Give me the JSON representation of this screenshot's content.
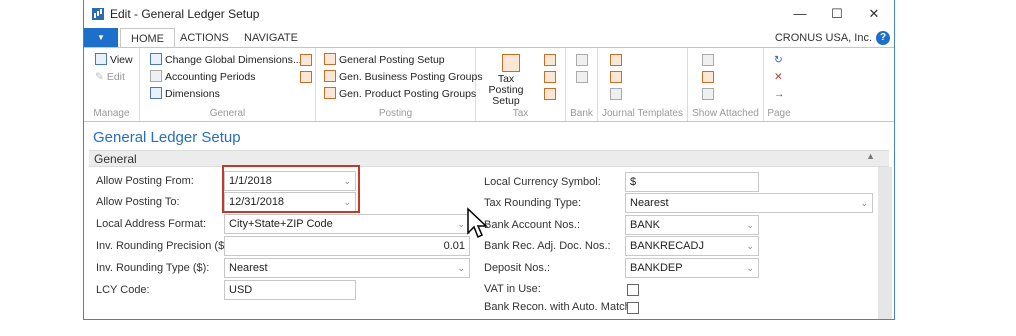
{
  "window": {
    "title": "Edit - General Ledger Setup"
  },
  "window_controls": {
    "minimize": "—",
    "maximize": "☐",
    "close": "✕"
  },
  "tabs": {
    "home": "HOME",
    "actions": "ACTIONS",
    "navigate": "NAVIGATE"
  },
  "company": "CRONUS USA, Inc.",
  "help": "?",
  "ribbon": {
    "manage": {
      "label": "Manage",
      "view": "View",
      "edit": "Edit"
    },
    "general": {
      "label": "General",
      "change_dims": "Change Global Dimensions...",
      "acc_periods": "Accounting Periods",
      "dimensions": "Dimensions"
    },
    "posting": {
      "label": "Posting",
      "gen_posting_setup": "General Posting Setup",
      "gen_bus_groups": "Gen. Business Posting Groups",
      "gen_prod_groups": "Gen. Product Posting Groups"
    },
    "tax": {
      "label": "Tax",
      "tax_posting_setup": "Tax Posting Setup"
    },
    "bank": {
      "label": "Bank"
    },
    "journal_templates": {
      "label": "Journal Templates"
    },
    "show_attached": {
      "label": "Show Attached"
    },
    "page": {
      "label": "Page"
    }
  },
  "page_title": "General Ledger Setup",
  "fasttab": {
    "label": "General"
  },
  "fields_left": [
    {
      "label": "Allow Posting From:",
      "value": "1/1/2018",
      "type": "dropdown"
    },
    {
      "label": "Allow Posting To:",
      "value": "12/31/2018",
      "type": "dropdown"
    },
    {
      "label": "Local Address Format:",
      "value": "City+State+ZIP Code",
      "type": "dropdown"
    },
    {
      "label": "Inv. Rounding Precision ($):",
      "value": "0.01",
      "type": "number"
    },
    {
      "label": "Inv. Rounding Type ($):",
      "value": "Nearest",
      "type": "dropdown"
    },
    {
      "label": "LCY Code:",
      "value": "USD",
      "type": "text"
    }
  ],
  "fields_right": [
    {
      "label": "Local Currency Symbol:",
      "value": "$",
      "type": "text"
    },
    {
      "label": "Tax Rounding Type:",
      "value": "Nearest",
      "type": "dropdown"
    },
    {
      "label": "Bank Account Nos.:",
      "value": "BANK",
      "type": "dropdown"
    },
    {
      "label": "Bank Rec. Adj. Doc. Nos.:",
      "value": "BANKRECADJ",
      "type": "dropdown"
    },
    {
      "label": "Deposit Nos.:",
      "value": "BANKDEP",
      "type": "dropdown"
    },
    {
      "label": "VAT in Use:",
      "checked": false,
      "type": "checkbox"
    },
    {
      "label": "Bank Recon. with Auto. Match:",
      "checked": false,
      "type": "checkbox"
    }
  ],
  "colors": {
    "accent": "#1d6fc9",
    "title_blue": "#2a6ebb",
    "highlight": "#c0392b"
  }
}
